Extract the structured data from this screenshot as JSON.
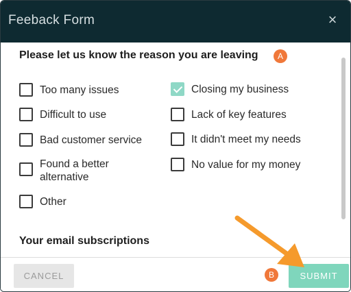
{
  "dialog": {
    "title": "Feeback Form",
    "close_glyph": "×"
  },
  "reason": {
    "heading": "Please let us know the reason you are leaving",
    "badge": "A",
    "options": [
      {
        "label": "Too many issues",
        "checked": false
      },
      {
        "label": "Difficult to use",
        "checked": false
      },
      {
        "label": "Bad customer service",
        "checked": false
      },
      {
        "label": "Found a better alternative",
        "checked": false
      },
      {
        "label": "Other",
        "checked": false
      },
      {
        "label": "Closing my business",
        "checked": true
      },
      {
        "label": "Lack of key features",
        "checked": false
      },
      {
        "label": "It didn't meet my needs",
        "checked": false
      },
      {
        "label": "No value for my money",
        "checked": false
      }
    ]
  },
  "subscriptions": {
    "heading": "Your email subscriptions"
  },
  "footer": {
    "cancel_label": "CANCEL",
    "submit_label": "SUBMIT",
    "badge": "B"
  },
  "colors": {
    "header_bg": "#0e2a31",
    "accent_teal": "#7fd6bc",
    "badge_orange": "#f0783a",
    "arrow_orange": "#f59a2c"
  },
  "icons": {
    "close": "close-icon",
    "check": "check-icon",
    "annotation_arrow": "arrow-icon"
  }
}
